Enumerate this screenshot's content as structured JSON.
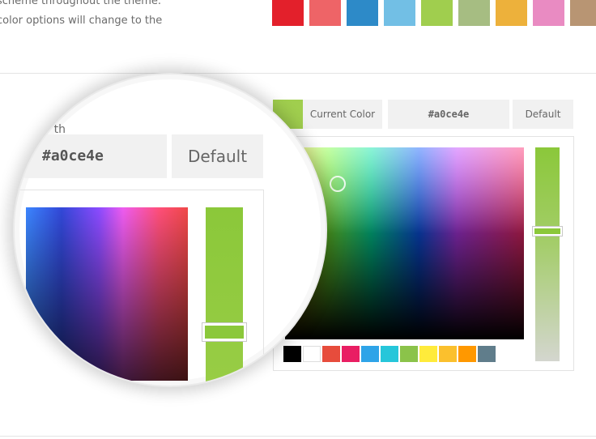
{
  "description": {
    "line1": "scheme throughout the theme.",
    "line2": "color options will change to the"
  },
  "palette": {
    "swatches": [
      "#e3202b",
      "#ee6467",
      "#2d8ac8",
      "#72bfe5",
      "#a0ce4e",
      "#a6bd82",
      "#edb13b",
      "#e98bc2",
      "#b89573"
    ]
  },
  "picker": {
    "current_color_label": "Current Color",
    "hex_value": "#a0ce4e",
    "default_label": "Default",
    "current_color": "#a0ce4e",
    "slider_level_fraction": 0.4,
    "mini_swatches": [
      "#000000",
      "#ffffff",
      "#e74c3c",
      "#e91e63",
      "#2ea4e8",
      "#26c6da",
      "#8bc34a",
      "#ffeb3b",
      "#fbc02d",
      "#ff9800",
      "#607d8b"
    ]
  },
  "magnifier": {
    "label": "ght color th",
    "hex_value": "#a0ce4e",
    "default_label": "Default"
  }
}
